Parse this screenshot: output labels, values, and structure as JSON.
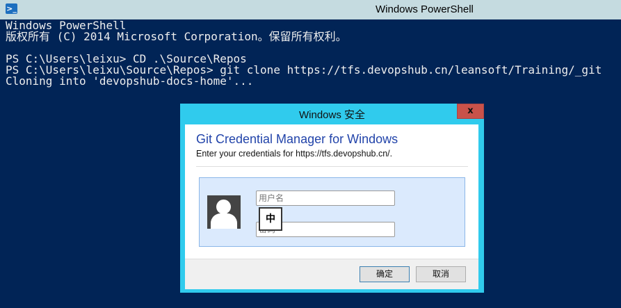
{
  "window": {
    "title": "Windows PowerShell",
    "icon": "powershell-icon"
  },
  "console": {
    "lines": [
      "Windows PowerShell",
      "版权所有 (C) 2014 Microsoft Corporation。保留所有权利。",
      "",
      "PS C:\\Users\\leixu> CD .\\Source\\Repos",
      "PS C:\\Users\\leixu\\Source\\Repos> git clone https://tfs.devopshub.cn/leansoft/Training/_git",
      "Cloning into 'devopshub-docs-home'..."
    ]
  },
  "dialog": {
    "title": "Windows 安全",
    "close": "x",
    "heading": "Git Credential Manager for Windows",
    "subtitle": "Enter your credentials for https://tfs.devopshub.cn/.",
    "username_placeholder": "用户名",
    "password_placeholder": "密码",
    "ime": "中",
    "ok": "确定",
    "cancel": "取消"
  },
  "colors": {
    "console_bg": "#012456",
    "dialog_frame": "#30cbed",
    "close": "#c9524a"
  }
}
